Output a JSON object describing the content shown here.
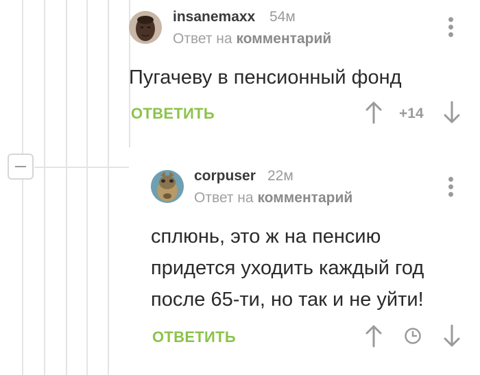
{
  "thread": {
    "collapse_icon": "minus-icon"
  },
  "comments": [
    {
      "author": "insanemaxx",
      "time": "54м",
      "reply_prefix": "Ответ на",
      "reply_target": "комментарий",
      "text": "Пугачеву в пенсионный фонд",
      "reply_label": "ОТВЕТИТЬ",
      "rating": "+14"
    },
    {
      "author": "corpuser",
      "time": "22м",
      "reply_prefix": "Ответ на",
      "reply_target": "комментарий",
      "text_lines": [
        "сплюнь, это ж  на пенсию",
        "придется уходить каждый год",
        "после 65-ти, но так и не уйти!"
      ],
      "reply_label": "ОТВЕТИТЬ"
    }
  ],
  "colors": {
    "accent": "#8bc34a",
    "muted": "#9a9a9a",
    "text": "#2a2a2a"
  }
}
